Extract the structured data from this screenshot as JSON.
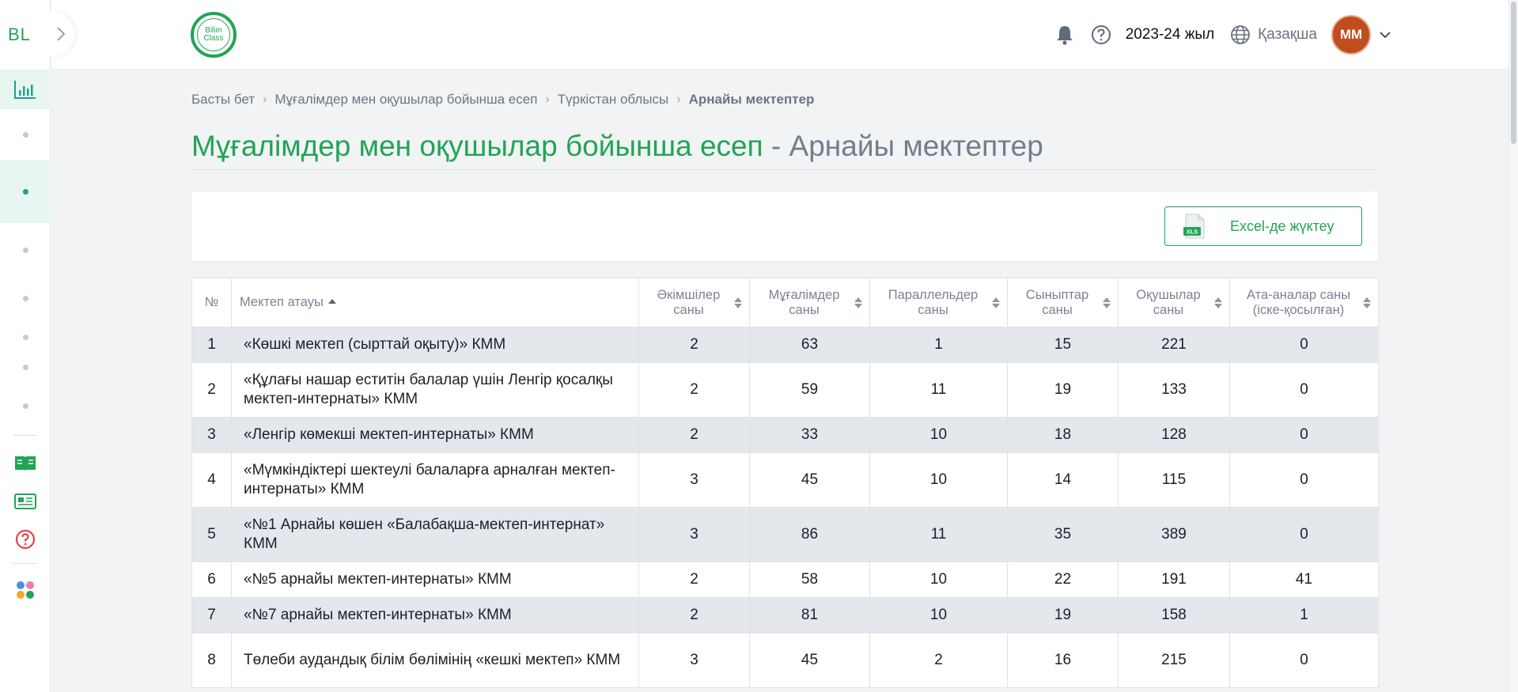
{
  "sidebar": {
    "logo": "BL",
    "toggle_icon": "chevron-right-icon"
  },
  "header": {
    "brand_line1": "Bilim",
    "brand_line2": "Class",
    "year": "2023-24 жыл",
    "language": "Қазақша",
    "avatar_initials": "ММ"
  },
  "breadcrumb": [
    "Басты бет",
    "Мұғалімдер мен оқушылар бойынша есеп",
    "Түркістан облысы",
    "Арнайы мектептер"
  ],
  "page": {
    "title_main": "Мұғалімдер мен оқушылар бойынша есеп",
    "title_sep": " - ",
    "title_sub": "Арнайы мектептер"
  },
  "toolbar": {
    "excel_label": "Excel-де жүктеу",
    "excel_icon_text": "XLS"
  },
  "table": {
    "columns": [
      "№",
      "Мектеп атауы",
      "Әкімшілер саны",
      "Мұғалімдер саны",
      "Параллельдер саны",
      "Сыныптар саны",
      "Оқушылар саны",
      "Ата-аналар саны (іске-қосылған)"
    ],
    "rows": [
      [
        "1",
        "«Көшкі мектеп (сырттай оқыту)» КММ",
        "2",
        "63",
        "1",
        "15",
        "221",
        "0"
      ],
      [
        "2",
        "«Құлағы нашар еститін балалар үшін Ленгір қосалқы мектеп-интернаты» КММ",
        "2",
        "59",
        "11",
        "19",
        "133",
        "0"
      ],
      [
        "3",
        "«Ленгір көмекші мектеп-интернаты» КММ",
        "2",
        "33",
        "10",
        "18",
        "128",
        "0"
      ],
      [
        "4",
        "«Мүмкіндіктері шектеулі балаларға арналған мектеп-интернаты» КММ",
        "3",
        "45",
        "10",
        "14",
        "115",
        "0"
      ],
      [
        "5",
        "«№1 Арнайы көшен «Балабақша-мектеп-интернат» КММ",
        "3",
        "86",
        "11",
        "35",
        "389",
        "0"
      ],
      [
        "6",
        "«№5 арнайы мектеп-интернаты» КММ",
        "2",
        "58",
        "10",
        "22",
        "191",
        "41"
      ],
      [
        "7",
        "«№7 арнайы мектеп-интернаты» КММ",
        "2",
        "81",
        "10",
        "19",
        "158",
        "1"
      ],
      [
        "8",
        "Төлеби аудандық білім бөлімінің «кешкі мектеп» КММ",
        "3",
        "45",
        "2",
        "16",
        "215",
        "0"
      ]
    ]
  }
}
